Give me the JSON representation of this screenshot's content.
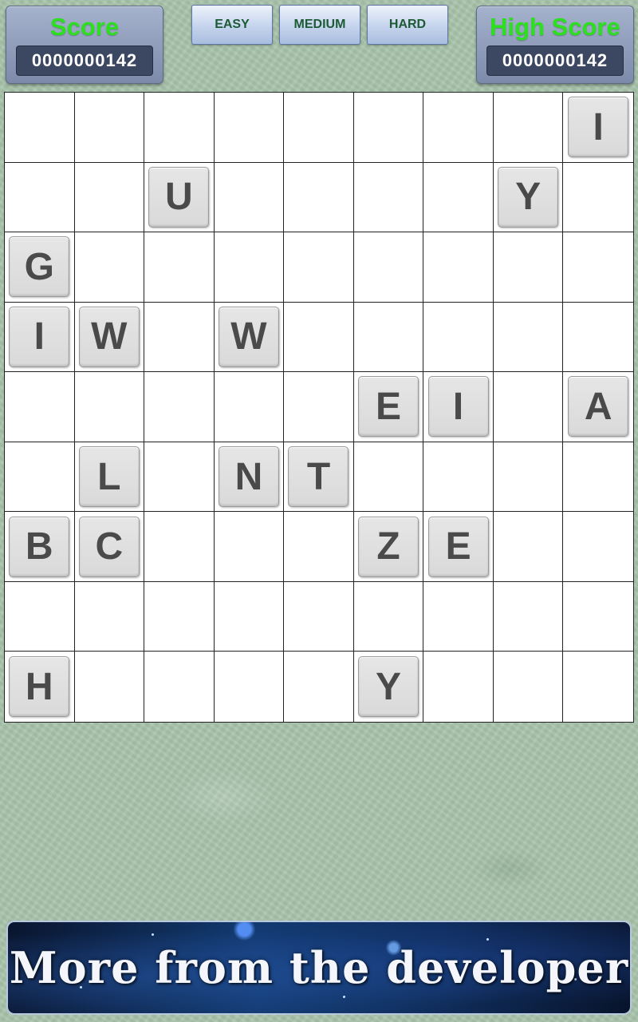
{
  "score": {
    "label": "Score",
    "value": "0000000142"
  },
  "high_score": {
    "label": "High Score",
    "value": "0000000142"
  },
  "difficulty": {
    "easy": "EASY",
    "medium": "MEDIUM",
    "hard": "HARD"
  },
  "board": {
    "rows": [
      [
        "",
        "",
        "",
        "",
        "",
        "",
        "",
        "",
        "I"
      ],
      [
        "",
        "",
        "U",
        "",
        "",
        "",
        "",
        "Y",
        ""
      ],
      [
        "G",
        "",
        "",
        "",
        "",
        "",
        "",
        "",
        ""
      ],
      [
        "I",
        "W",
        "",
        "W",
        "",
        "",
        "",
        "",
        ""
      ],
      [
        "",
        "",
        "",
        "",
        "",
        "E",
        "I",
        "",
        "A"
      ],
      [
        "",
        "L",
        "",
        "N",
        "T",
        "",
        "",
        "",
        ""
      ],
      [
        "B",
        "C",
        "",
        "",
        "",
        "Z",
        "E",
        "",
        ""
      ],
      [
        "",
        "",
        "",
        "",
        "",
        "",
        "",
        "",
        ""
      ],
      [
        "H",
        "",
        "",
        "",
        "",
        "Y",
        "",
        "",
        ""
      ]
    ]
  },
  "banner": {
    "text": "More from the developer"
  },
  "colors": {
    "score_label": "#2cdf1f",
    "difficulty_text": "#1d5a36",
    "tile_letter": "#4a4a4a",
    "background": "#a9c4ac"
  }
}
